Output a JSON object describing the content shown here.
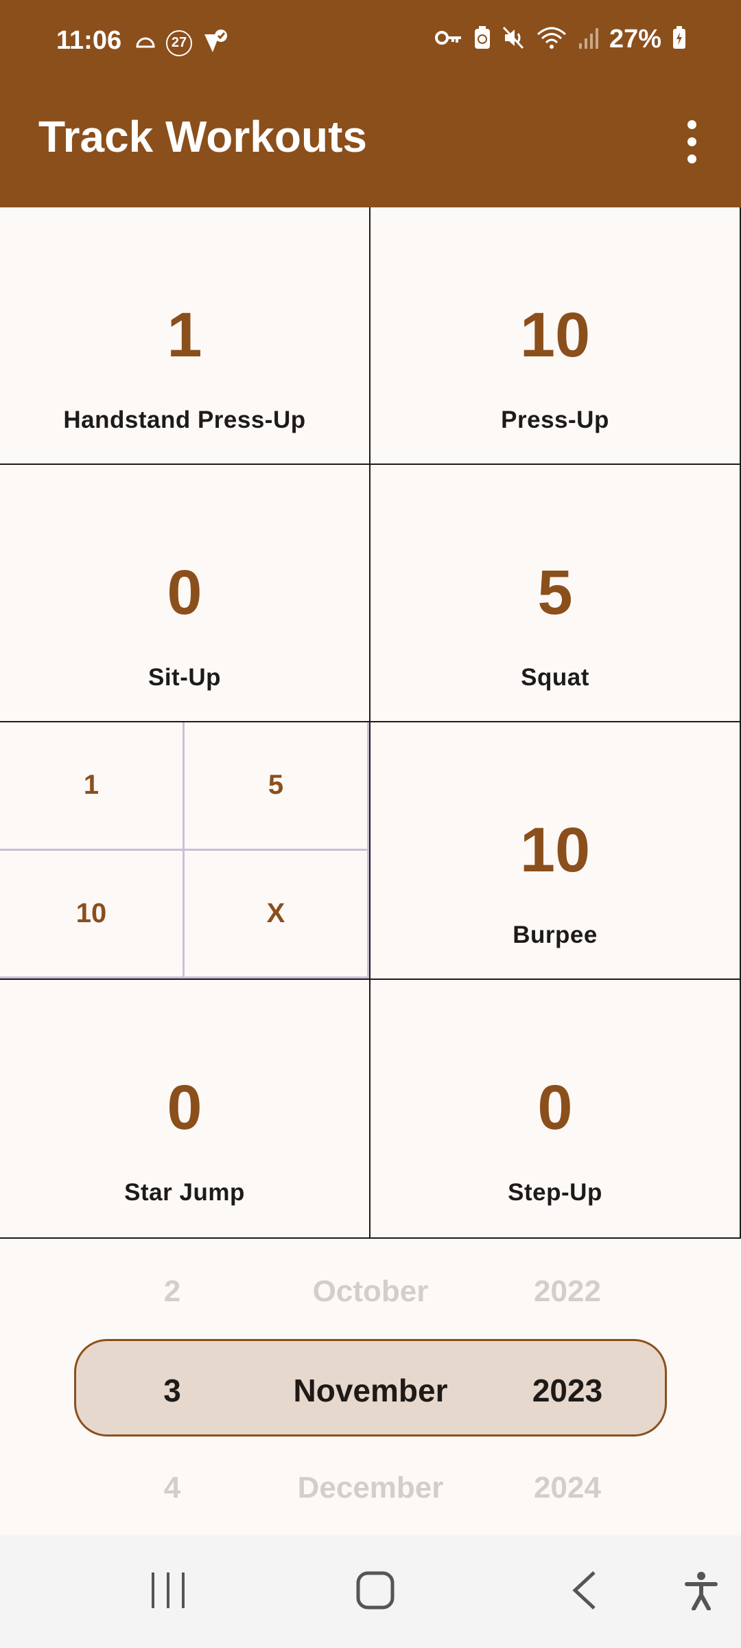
{
  "status_bar": {
    "time": "11:06",
    "notification_badge": "27",
    "battery": "27%",
    "icons": [
      "cloud-icon",
      "badge-27-icon",
      "check-shield-icon",
      "vpn-key-icon",
      "battery-saver-icon",
      "mute-icon",
      "wifi-icon",
      "signal-icon",
      "battery-charging-icon"
    ]
  },
  "app_bar": {
    "title": "Track Workouts",
    "menu_icon": "more-vert-icon"
  },
  "exercises": [
    {
      "count": "1",
      "name": "Handstand Press-Up"
    },
    {
      "count": "10",
      "name": "Press-Up"
    },
    {
      "count": "0",
      "name": "Sit-Up"
    },
    {
      "count": "5",
      "name": "Squat"
    },
    {
      "keypad": [
        "1",
        "5",
        "10",
        "X"
      ]
    },
    {
      "count": "10",
      "name": "Burpee"
    },
    {
      "count": "0",
      "name": "Star Jump"
    },
    {
      "count": "0",
      "name": "Step-Up"
    }
  ],
  "date_picker": {
    "previous": {
      "day": "2",
      "month": "October",
      "year": "2022"
    },
    "selected": {
      "day": "3",
      "month": "November",
      "year": "2023"
    },
    "next": {
      "day": "4",
      "month": "December",
      "year": "2024"
    }
  },
  "nav_bar": {
    "icons": [
      "recent-apps-icon",
      "home-icon",
      "back-icon",
      "accessibility-icon"
    ]
  },
  "colors": {
    "primary": "#8B4F1C",
    "background": "#FDF9F7",
    "selected_band": "#E6D8CC",
    "faded_text": "#D4CECB",
    "keypad_border": "#C9C0D6"
  }
}
